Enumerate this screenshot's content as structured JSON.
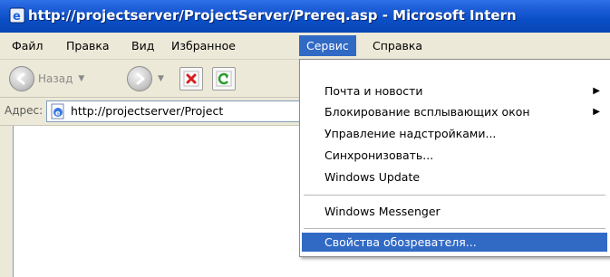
{
  "window": {
    "title": "http://projectserver/ProjectServer/Prereq.asp - Microsoft Intern"
  },
  "menubar": {
    "items": [
      "Файл",
      "Правка",
      "Вид",
      "Избранное",
      "Сервис",
      "Справка"
    ],
    "active": "Сервис"
  },
  "toolbar": {
    "back_label": "Назад",
    "icons": [
      "back-icon",
      "forward-icon",
      "stop-icon",
      "refresh-icon"
    ]
  },
  "address": {
    "label": "Адрес:",
    "value": "http://projectserver/Project"
  },
  "dropdown": {
    "items": [
      {
        "label": "Почта и новости",
        "submenu": true
      },
      {
        "label": "Блокирование всплывающих окон",
        "submenu": true
      },
      {
        "label": "Управление надстройками...",
        "submenu": false
      },
      {
        "label": "Синхронизовать...",
        "submenu": false
      },
      {
        "label": "Windows Update",
        "submenu": false
      },
      {
        "label": "Windows Messenger",
        "submenu": false
      },
      {
        "label": "Свойства обозревателя...",
        "submenu": false,
        "selected": true
      }
    ]
  },
  "colors": {
    "titlebar": "#0a4fc6",
    "selection": "#316ac5"
  }
}
